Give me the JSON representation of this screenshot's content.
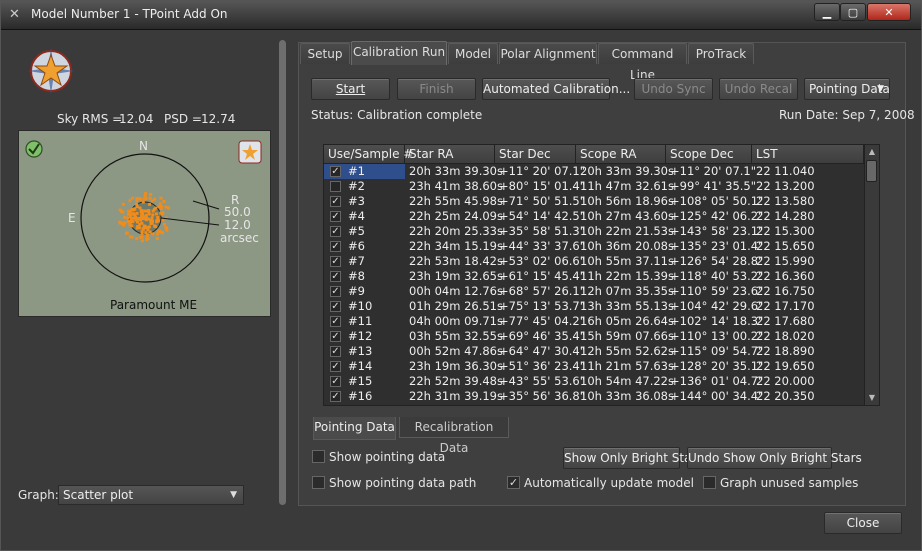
{
  "window": {
    "title": "Model Number 1 - TPoint Add On",
    "app_icon": "x-logo-icon"
  },
  "left": {
    "sky_rms_label": "Sky RMS =",
    "sky_rms_value": "12.04",
    "psd_label": "PSD =",
    "psd_value": "12.74",
    "compass": {
      "n": "N",
      "e": "E"
    },
    "radius": {
      "r": "R",
      "outer": "50.0",
      "inner": "12.0",
      "unit": "arcsec"
    },
    "mount_name": "Paramount ME",
    "graph_label": "Graph:",
    "graph_value": "Scatter plot"
  },
  "tabs": [
    "Setup",
    "Calibration Run",
    "Model",
    "Polar Alignment",
    "Command Line",
    "ProTrack"
  ],
  "active_tab": "Calibration Run",
  "toolbar": {
    "start": "Start",
    "finish": "Finish",
    "automated": "Automated Calibration...",
    "undo_sync": "Undo Sync",
    "undo_recal": "Undo Recal",
    "pointing_data": "Pointing Data"
  },
  "status": "Status: Calibration complete",
  "run_date": "Run Date: Sep 7, 2008",
  "table": {
    "columns": [
      "Use/Sample #",
      "Star RA",
      "Star Dec",
      "Scope RA",
      "Scope Dec",
      "LST"
    ],
    "rows": [
      {
        "use": true,
        "sample": "#1",
        "star_ra": "20h 33m 39.30s",
        "star_dec": "+11° 20' 07.1\"",
        "scope_ra": "20h 33m 39.30s",
        "scope_dec": "+11° 20' 07.1\"",
        "lst": "22 11.040"
      },
      {
        "use": false,
        "sample": "#2",
        "star_ra": "23h 41m 38.60s",
        "star_dec": "+80° 15' 01.4\"",
        "scope_ra": "11h 47m 32.61s",
        "scope_dec": "+99° 41' 35.5\"",
        "lst": "22 13.200"
      },
      {
        "use": true,
        "sample": "#3",
        "star_ra": "22h 55m 45.98s",
        "star_dec": "+71° 50' 51.5\"",
        "scope_ra": "10h 56m 18.96s",
        "scope_dec": "+108° 05' 50.1\"",
        "lst": "22 13.580"
      },
      {
        "use": true,
        "sample": "#4",
        "star_ra": "22h 25m 24.09s",
        "star_dec": "+54° 14' 42.5\"",
        "scope_ra": "10h 27m 43.60s",
        "scope_dec": "+125° 42' 06.2\"",
        "lst": "22 14.280"
      },
      {
        "use": true,
        "sample": "#5",
        "star_ra": "22h 20m 25.33s",
        "star_dec": "+35° 58' 51.3\"",
        "scope_ra": "10h 22m 21.53s",
        "scope_dec": "+143° 58' 23.1\"",
        "lst": "22 15.300"
      },
      {
        "use": true,
        "sample": "#6",
        "star_ra": "22h 34m 15.19s",
        "star_dec": "+44° 33' 37.6\"",
        "scope_ra": "10h 36m 20.08s",
        "scope_dec": "+135° 23' 01.4\"",
        "lst": "22 15.650"
      },
      {
        "use": true,
        "sample": "#7",
        "star_ra": "22h 53m 18.42s",
        "star_dec": "+53° 02' 06.6\"",
        "scope_ra": "10h 55m 37.11s",
        "scope_dec": "+126° 54' 28.8\"",
        "lst": "22 15.990"
      },
      {
        "use": true,
        "sample": "#8",
        "star_ra": "23h 19m 32.65s",
        "star_dec": "+61° 15' 45.4\"",
        "scope_ra": "11h 22m 15.39s",
        "scope_dec": "+118° 40' 53.2\"",
        "lst": "22 16.360"
      },
      {
        "use": true,
        "sample": "#9",
        "star_ra": "00h 04m 12.76s",
        "star_dec": "+68° 57' 26.1\"",
        "scope_ra": "12h 07m 35.35s",
        "scope_dec": "+110° 59' 23.6\"",
        "lst": "22 16.750"
      },
      {
        "use": true,
        "sample": "#10",
        "star_ra": "01h 29m 26.51s",
        "star_dec": "+75° 13' 53.7\"",
        "scope_ra": "13h 33m 55.13s",
        "scope_dec": "+104° 42' 29.6\"",
        "lst": "22 17.170"
      },
      {
        "use": true,
        "sample": "#11",
        "star_ra": "04h 00m 09.71s",
        "star_dec": "+77° 45' 04.2\"",
        "scope_ra": "16h 05m 26.64s",
        "scope_dec": "+102° 14' 18.3\"",
        "lst": "22 17.680"
      },
      {
        "use": true,
        "sample": "#12",
        "star_ra": "03h 55m 32.55s",
        "star_dec": "+69° 46' 35.4\"",
        "scope_ra": "15h 59m 07.66s",
        "scope_dec": "+110° 13' 00.2\"",
        "lst": "22 18.020"
      },
      {
        "use": true,
        "sample": "#13",
        "star_ra": "00h 52m 47.86s",
        "star_dec": "+64° 47' 30.4\"",
        "scope_ra": "12h 55m 52.62s",
        "scope_dec": "+115° 09' 54.7\"",
        "lst": "22 18.890"
      },
      {
        "use": true,
        "sample": "#14",
        "star_ra": "23h 19m 36.30s",
        "star_dec": "+51° 36' 23.4\"",
        "scope_ra": "11h 21m 57.63s",
        "scope_dec": "+128° 20' 35.1\"",
        "lst": "22 19.650"
      },
      {
        "use": true,
        "sample": "#15",
        "star_ra": "22h 52m 39.48s",
        "star_dec": "+43° 55' 53.6\"",
        "scope_ra": "10h 54m 47.22s",
        "scope_dec": "+136° 01' 04.7\"",
        "lst": "22 20.000"
      },
      {
        "use": true,
        "sample": "#16",
        "star_ra": "22h 31m 39.19s",
        "star_dec": "+35° 56' 36.8\"",
        "scope_ra": "10h 33m 36.08s",
        "scope_dec": "+144° 00' 34.4\"",
        "lst": "22 20.350"
      }
    ]
  },
  "bottom_tabs": [
    "Pointing Data",
    "Recalibration Data"
  ],
  "options": {
    "show_pointing_data": "Show pointing data",
    "show_pointing_data_checked": false,
    "show_pointing_data_path": "Show pointing data path",
    "show_pointing_data_path_checked": false,
    "auto_update_model": "Automatically update model",
    "auto_update_model_checked": true,
    "graph_unused": "Graph unused samples",
    "graph_unused_checked": false,
    "show_bright": "Show Only Bright Stars",
    "undo_bright": "Undo Show Only Bright Stars"
  },
  "close": "Close",
  "colors": {
    "accent": "#2f4e8c",
    "scatter": "#f08c1c",
    "graph_bg": "#8c9784"
  }
}
